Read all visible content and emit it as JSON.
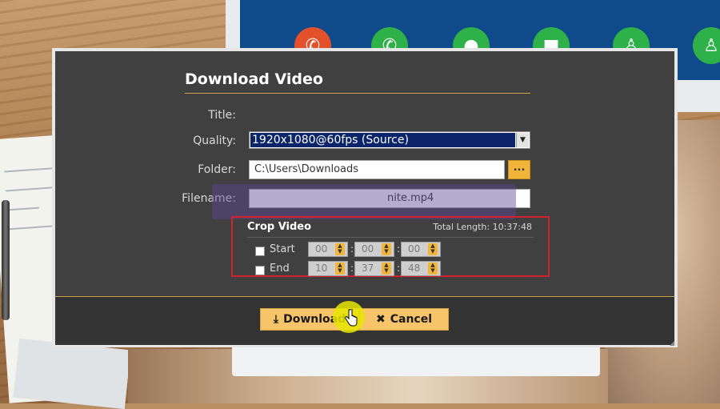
{
  "dialog": {
    "title": "Download Video",
    "fields": {
      "title_label": "Title:",
      "quality_label": "Quality:",
      "quality_value": "1920x1080@60fps (Source)",
      "folder_label": "Folder:",
      "folder_value": "C:\\Users\\Downloads",
      "filename_label": "Filename:",
      "filename_value": "nite.mp4",
      "browse_label": "..."
    },
    "crop": {
      "title": "Crop Video",
      "total_length": "Total Length: 10:37:48",
      "start": {
        "label": "Start",
        "h": "00",
        "m": "00",
        "s": "00"
      },
      "end": {
        "label": "End",
        "h": "10",
        "m": "37",
        "s": "48"
      }
    },
    "buttons": {
      "download": "Download",
      "cancel": "Cancel"
    }
  },
  "colors": {
    "panel": "#404040",
    "accent": "#f2b53a",
    "highlight": "#d4202a",
    "selection": "#0b246a"
  }
}
